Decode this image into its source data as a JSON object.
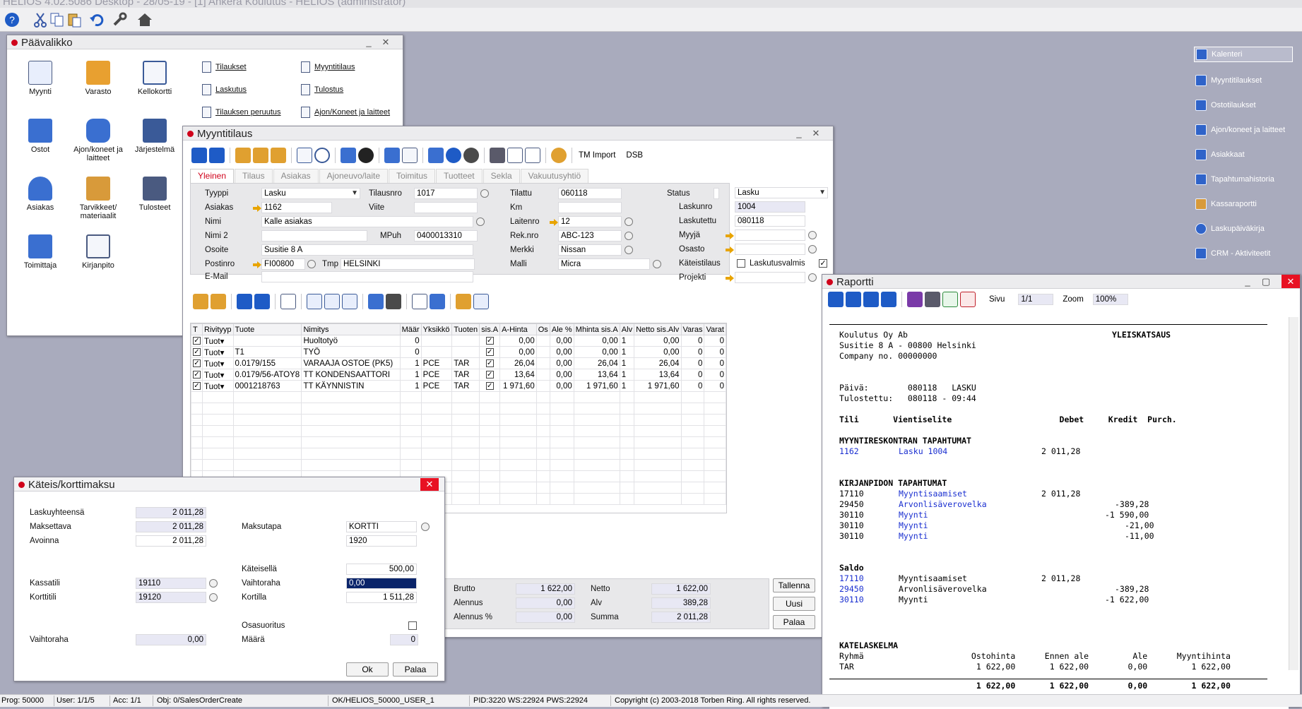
{
  "app": {
    "title": "HELIOS 4.02.5086 Desktop - 28/05-19 - [1] Ankera Koulutus - HELIOS (administrator)"
  },
  "main_menu": {
    "title": "Päävalikko",
    "items": [
      {
        "label": "Myynti",
        "icon": "sales-doc-icon"
      },
      {
        "label": "Varasto",
        "icon": "warehouse-icon"
      },
      {
        "label": "Kellokortti",
        "icon": "calendar-icon"
      },
      {
        "label": "Ostot",
        "icon": "shop-icon"
      },
      {
        "label": "Ajon/koneet ja laitteet",
        "icon": "car-icon"
      },
      {
        "label": "Järjestelmä",
        "icon": "gear-icon"
      },
      {
        "label": "Asiakas",
        "icon": "person-icon"
      },
      {
        "label": "Tarvikkeet/ materiaalit",
        "icon": "boxes-icon"
      },
      {
        "label": "Tulosteet",
        "icon": "printer-icon"
      },
      {
        "label": "Toimittaja",
        "icon": "factory-icon"
      },
      {
        "label": "Kirjanpito",
        "icon": "bank-icon"
      }
    ],
    "links": [
      "Tilaukset",
      "Myyntitilaus",
      "Laskutus",
      "Tulostus",
      "Tilauksen peruutus",
      "Ajon/Koneet ja laitteet"
    ]
  },
  "sidebar": {
    "items": [
      "Kalenteri",
      "Myyntitilaukset",
      "Ostotilaukset",
      "Ajon/koneet ja laitteet",
      "Asiakkaat",
      "Tapahtumahistoria",
      "Kassaraportti",
      "Laskupäiväkirja",
      "CRM - Aktiviteetit"
    ]
  },
  "order": {
    "title": "Myyntitilaus",
    "toolbar_text": [
      "TM Import",
      "DSB"
    ],
    "tabs": [
      "Yleinen",
      "Tilaus",
      "Asiakas",
      "Ajoneuvo/laite",
      "Toimitus",
      "Tuotteet",
      "Sekla",
      "Vakuutusyhtiö"
    ],
    "labels": {
      "tyyppi": "Tyyppi",
      "asiakas": "Asiakas",
      "nimi": "Nimi",
      "nimi2": "Nimi 2",
      "osoite": "Osoite",
      "postinro": "Postinro",
      "tmp": "Tmp",
      "email": "E-Mail",
      "tilausnro": "Tilausnro",
      "viite": "Viite",
      "mpuh": "MPuh",
      "tilattu": "Tilattu",
      "km": "Km",
      "laitenro": "Laitenro",
      "reknro": "Rek.nro",
      "merkki": "Merkki",
      "malli": "Malli",
      "status": "Status",
      "laskunro": "Laskunro",
      "laskutettu": "Laskutettu",
      "myyja": "Myyjä",
      "osasto": "Osasto",
      "kateistilaus": "Käteistilaus",
      "laskutusvalmis": "Laskutusvalmis",
      "projekti": "Projekti"
    },
    "values": {
      "tyyppi": "Lasku",
      "asiakas": "1162",
      "nimi": "Kalle asiakas",
      "nimi2": "",
      "osoite": "Susitie 8 A",
      "postinro": "FI00800",
      "tmp": "HELSINKI",
      "email": "",
      "tilausnro": "1017",
      "viite": "",
      "mpuh": "0400013310",
      "tilattu": "060118",
      "km": "",
      "laitenro": "12",
      "reknro": "ABC-123",
      "merkki": "Nissan",
      "malli": "Micra",
      "status": "Lasku",
      "laskunro": "1004",
      "laskutettu": "080118",
      "myyja": "",
      "osasto": "",
      "projekti": ""
    },
    "grid": {
      "columns": [
        "T",
        "Rivityyp",
        "Tuote",
        "Nimitys",
        "Määr",
        "Yksikkö",
        "Tuoten",
        "sis.A",
        "A-Hinta",
        "Os",
        "Ale %",
        "Mhinta sis.A",
        "Alv",
        "Netto sis.Alv",
        "Varas",
        "Varat"
      ],
      "rows": [
        {
          "type": "Tuot",
          "product": "",
          "name": "Huoltotyö",
          "qty": "0",
          "unit": "",
          "group": "",
          "a_price": "0,00",
          "ale": "0,00",
          "mprice": "0,00",
          "alv": "1",
          "net": "0,00",
          "varas": "0",
          "varat": "0"
        },
        {
          "type": "Tuot",
          "product": "T1",
          "name": "TYÖ",
          "qty": "0",
          "unit": "",
          "group": "",
          "a_price": "0,00",
          "ale": "0,00",
          "mprice": "0,00",
          "alv": "1",
          "net": "0,00",
          "varas": "0",
          "varat": "0"
        },
        {
          "type": "Tuot",
          "product": "0.0179/155",
          "name": "VARAAJA OSTOE (PK5)",
          "qty": "1",
          "unit": "PCE",
          "group": "TAR",
          "a_price": "26,04",
          "ale": "0,00",
          "mprice": "26,04",
          "alv": "1",
          "net": "26,04",
          "varas": "0",
          "varat": "0"
        },
        {
          "type": "Tuot",
          "product": "0.0179/56-ATOY8",
          "name": "TT KONDENSAATTORI",
          "qty": "1",
          "unit": "PCE",
          "group": "TAR",
          "a_price": "13,64",
          "ale": "0,00",
          "mprice": "13,64",
          "alv": "1",
          "net": "13,64",
          "varas": "0",
          "varat": "0"
        },
        {
          "type": "Tuot",
          "product": "0001218763",
          "name": "TT KÄYNNISTIN",
          "qty": "1",
          "unit": "PCE",
          "group": "TAR",
          "a_price": "1 971,60",
          "ale": "0,00",
          "mprice": "1 971,60",
          "alv": "1",
          "net": "1 971,60",
          "varas": "0",
          "varat": "0"
        }
      ]
    },
    "totals": {
      "brutto_label": "Brutto",
      "brutto": "1 622,00",
      "alennus_label": "Alennus",
      "alennus": "0,00",
      "alennus_pct_label": "Alennus %",
      "alennus_pct": "0,00",
      "netto_label": "Netto",
      "netto": "1 622,00",
      "alv_label": "Alv",
      "alv": "389,28",
      "summa_label": "Summa",
      "summa": "2 011,28"
    },
    "buttons": {
      "save": "Tallenna",
      "new": "Uusi",
      "back": "Palaa"
    }
  },
  "payment": {
    "title": "Käteis/korttimaksu",
    "labels": {
      "laskuyhteensa": "Laskuyhteensä",
      "maksettava": "Maksettava",
      "avoinna": "Avoinna",
      "kassatili": "Kassatili",
      "korttitili": "Korttitili",
      "vaihtoraha_left": "Vaihtoraha",
      "maksutapa": "Maksutapa",
      "kateisella": "Käteisellä",
      "vaihtoraha": "Vaihtoraha",
      "kortilla": "Kortilla",
      "osasuoritus": "Osasuoritus",
      "maara": "Määrä"
    },
    "values": {
      "laskuyhteensa": "2 011,28",
      "maksettava": "2 011,28",
      "avoinna": "2 011,28",
      "kassatili": "19110",
      "korttitili": "19120",
      "vaihtoraha_left": "0,00",
      "maksutapa": "KORTTI",
      "maksutapa_code": "1920",
      "kateisella": "500,00",
      "vaihtoraha": "0,00",
      "kortilla": "1 511,28",
      "maara": "0"
    },
    "buttons": {
      "ok": "Ok",
      "back": "Palaa"
    }
  },
  "report": {
    "title": "Raportti",
    "page_label": "Sivu",
    "page": "1/1",
    "zoom_label": "Zoom",
    "zoom": "100%",
    "company": "Koulutus Oy Ab",
    "address": "Susitie 8 A - 00800 Helsinki",
    "company_no": "Company no. 00000000",
    "heading": "YLEISKATSAUS",
    "date_line": "Päivä:        080118   LASKU",
    "printed_line": "Tulostettu:   080118 - 09:44",
    "col_headers": "Tili       Vientiselite                      Debet     Kredit  Purch.",
    "sec1": "MYYNTIRESKONTRAN TAPAHTUMAT",
    "s1r1_acc": "1162",
    "s1r1_desc": "Lasku 1004",
    "s1r1_amt": "2 011,28",
    "sec2": "KIRJANPIDON TAPAHTUMAT",
    "s2": [
      {
        "acc": "17110",
        "desc": "Myyntisaamiset",
        "debet": "2 011,28",
        "kredit": ""
      },
      {
        "acc": "29450",
        "desc": "Arvonlisäverovelka",
        "debet": "",
        "kredit": "-389,28"
      },
      {
        "acc": "30110",
        "desc": "Myynti",
        "debet": "",
        "kredit": "-1 590,00"
      },
      {
        "acc": "30110",
        "desc": "Myynti",
        "debet": "",
        "kredit": "-21,00"
      },
      {
        "acc": "30110",
        "desc": "Myynti",
        "debet": "",
        "kredit": "-11,00"
      }
    ],
    "sec3": "Saldo",
    "s3": [
      {
        "acc": "17110",
        "desc": "Myyntisaamiset",
        "debet": "2 011,28",
        "kredit": ""
      },
      {
        "acc": "29450",
        "desc": "Arvonlisäverovelka",
        "debet": "",
        "kredit": "-389,28"
      },
      {
        "acc": "30110",
        "desc": "Myynti",
        "debet": "",
        "kredit": "-1 622,00"
      }
    ],
    "sec4": "KATELASKELMA",
    "kate_header": "Ryhmä                      Ostohinta      Ennen ale         Ale      Myyntihinta",
    "kate_row": "TAR                         1 622,00       1 622,00        0,00         1 622,00",
    "kate_total": "                            1 622,00       1 622,00        0,00         1 622,00"
  },
  "status_bar": {
    "prog": "Prog: 50000",
    "user": "User: 1/1/5",
    "acc": "Acc: 1/1",
    "obj": "Obj: 0/SalesOrderCreate",
    "conn": "OK/HELIOS_50000_USER_1",
    "pid": "PID:3220 WS:22924 PWS:22924",
    "copyright": "Copyright (c) 2003-2018 Torben Ring. All rights reserved."
  }
}
